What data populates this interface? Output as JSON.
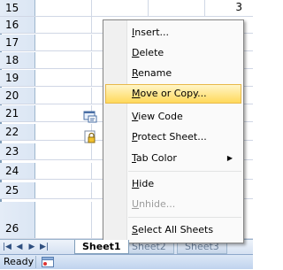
{
  "grid": {
    "row_numbers": [
      "15",
      "16",
      "17",
      "18",
      "19",
      "20",
      "21",
      "22",
      "23",
      "24",
      "25",
      "26"
    ],
    "top_cell_value": "3"
  },
  "context_menu": {
    "items": [
      {
        "label": "Insert...",
        "accel": "I",
        "rest": "nsert..."
      },
      {
        "label": "Delete",
        "accel": "D",
        "rest": "elete"
      },
      {
        "label": "Rename",
        "accel": "R",
        "rest": "ename"
      },
      {
        "label": "Move or Copy...",
        "accel": "M",
        "rest": "ove or Copy...",
        "highlighted": true
      },
      {
        "label": "View Code",
        "accel": "V",
        "rest": "iew Code",
        "icon": "view-code-icon"
      },
      {
        "label": "Protect Sheet...",
        "accel": "P",
        "rest": "rotect Sheet...",
        "icon": "protect-sheet-icon"
      },
      {
        "label": "Tab Color",
        "accel": "T",
        "rest": "ab Color",
        "submenu": true
      },
      {
        "label": "Hide",
        "accel": "H",
        "rest": "ide"
      },
      {
        "label": "Unhide...",
        "accel": "U",
        "rest": "nhide...",
        "disabled": true
      },
      {
        "label": "Select All Sheets",
        "accel": "S",
        "rest": "elect All Sheets"
      }
    ],
    "submenu_glyph": "▶"
  },
  "sheet_tabs": {
    "nav": [
      "|◀",
      "◀",
      "▶",
      "▶|"
    ],
    "tabs": [
      "Sheet1",
      "Sheet2",
      "Sheet3"
    ],
    "active": "Sheet1"
  },
  "status_bar": {
    "text": "Ready",
    "icon": "macro-record-icon"
  },
  "colors": {
    "menu_highlight": "#ffd95b",
    "header_bg": "#dbe6f4",
    "gridline": "#d0d7e5"
  }
}
